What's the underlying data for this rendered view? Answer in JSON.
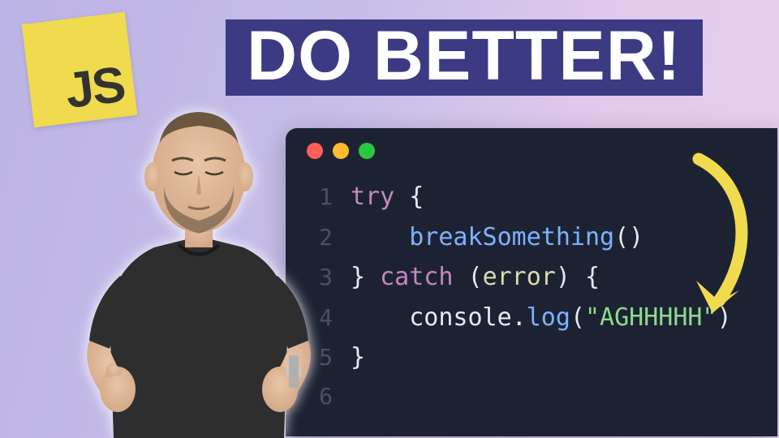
{
  "logo": {
    "text": "JS"
  },
  "headline": {
    "text": "DO BETTER!"
  },
  "colors": {
    "banner_bg": "#3d3a84",
    "banner_fg": "#ffffff",
    "code_bg": "#1d2233",
    "js_logo_bg": "#f0db4f",
    "arrow": "#f0db4f"
  },
  "code": {
    "traffic_lights": [
      "red",
      "yellow",
      "green"
    ],
    "lines": [
      {
        "n": "1",
        "tokens": [
          [
            "kw",
            "try"
          ],
          [
            "p",
            " {"
          ]
        ]
      },
      {
        "n": "2",
        "tokens": [
          [
            "p",
            "    "
          ],
          [
            "fn",
            "breakSomething"
          ],
          [
            "p",
            "()"
          ]
        ]
      },
      {
        "n": "3",
        "tokens": [
          [
            "p",
            "} "
          ],
          [
            "kw",
            "catch"
          ],
          [
            "p",
            " ("
          ],
          [
            "var",
            "error"
          ],
          [
            "p",
            ") {"
          ]
        ]
      },
      {
        "n": "4",
        "tokens": [
          [
            "p",
            "    "
          ],
          [
            "obj",
            "console"
          ],
          [
            "p",
            "."
          ],
          [
            "fn",
            "log"
          ],
          [
            "p",
            "("
          ],
          [
            "str",
            "\"AGHHHHH\""
          ],
          [
            "p",
            ")"
          ]
        ]
      },
      {
        "n": "5",
        "tokens": [
          [
            "p",
            "}"
          ]
        ]
      },
      {
        "n": "6",
        "tokens": []
      }
    ]
  },
  "icons": {
    "arrow": "curved-arrow-icon",
    "person": "meditating-man-figure"
  }
}
